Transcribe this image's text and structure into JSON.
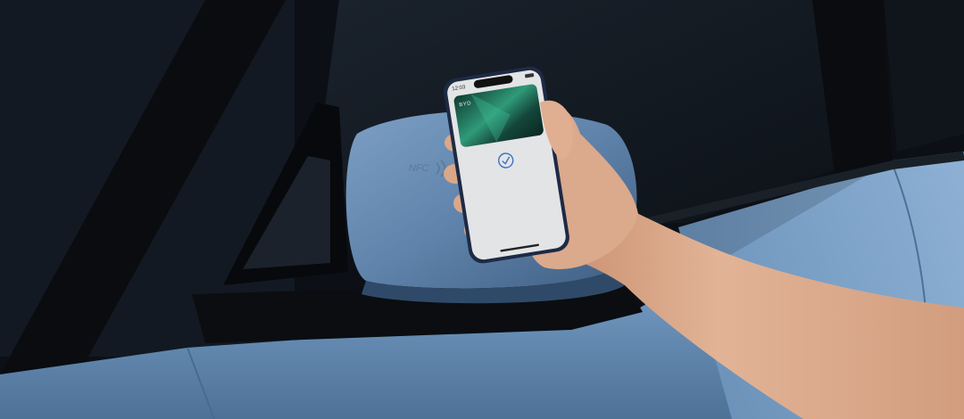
{
  "phone": {
    "status_time": "12:03",
    "card_logo": "BYD"
  },
  "mirror": {
    "nfc_label": "NFC"
  },
  "colors": {
    "background": "#0c1016",
    "car_body": "#7fa3c9",
    "window_glass": "#111820",
    "pillar_black": "#0a0c10",
    "card_green": "#1f6b55",
    "screen_grey": "#e3e4e6",
    "skin": "#d9a88a",
    "check_accent": "#3a73c2"
  },
  "icons": {
    "confirmation": "check-circle-icon"
  }
}
